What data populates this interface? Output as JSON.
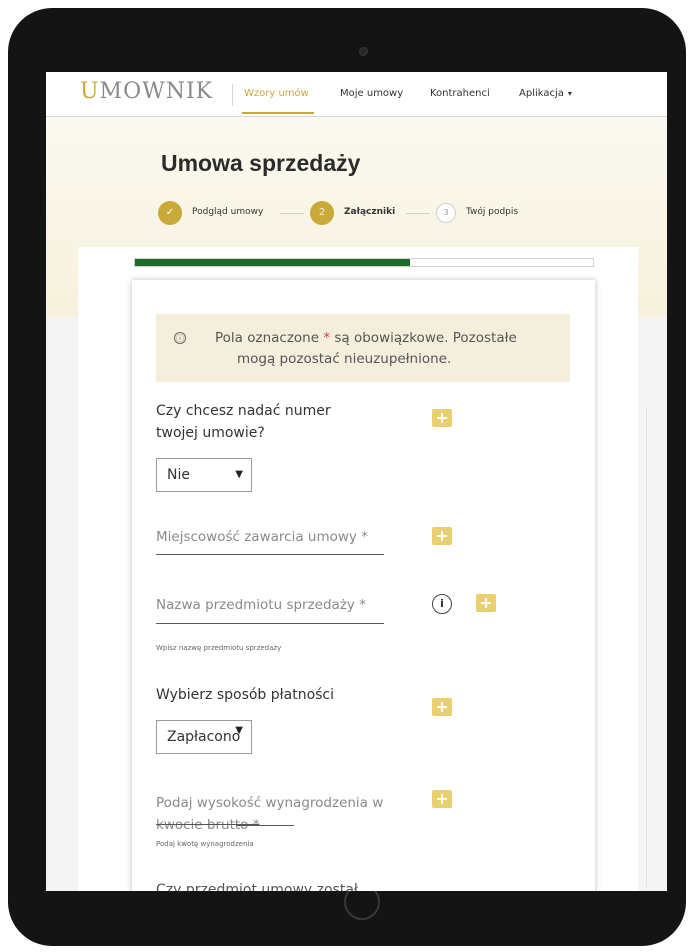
{
  "app": {
    "logo_u": "U",
    "logo_rest": "MOWNIK"
  },
  "nav": {
    "items": [
      {
        "label": "Wzory umów",
        "active": true
      },
      {
        "label": "Moje umowy"
      },
      {
        "label": "Kontrahenci"
      },
      {
        "label": "Aplikacja"
      }
    ],
    "dropdown_chevron": "▾"
  },
  "page": {
    "title": "Umowa sprzedaży"
  },
  "steps": [
    {
      "number": "✓",
      "label": "Podgląd umowy",
      "state": "done"
    },
    {
      "number": "2",
      "label": "Załączniki",
      "state": "current"
    },
    {
      "number": "3",
      "label": "Twój podpis",
      "state": "todo"
    }
  ],
  "progress": {
    "fraction": 0.6,
    "color": "#1e6b2b"
  },
  "notice": {
    "icon": "ⓘ",
    "text_before": "Pola oznaczone ",
    "star": "*",
    "text_after": " są obowiązkowe. Pozostałe",
    "line2": "mogą pozostać nieuzupełnione."
  },
  "form": {
    "contract_number": {
      "question_line1": "Czy chcesz nadać numer",
      "question_line2": "twojej umowie?",
      "value": "Nie",
      "arrow": "▼"
    },
    "place": {
      "label": "Miejscowość zawarcia umowy *"
    },
    "item_name": {
      "label": "Nazwa przedmiotu sprzedaży *",
      "info_icon": "i",
      "helper": "Wpisz nazwę przedmiotu sprzedaży"
    },
    "payment_method": {
      "question": "Wybierz sposób płatności",
      "value": "Zapłacono",
      "arrow": "▼"
    },
    "amount": {
      "label_line1": "Podaj wysokość wynagrodzenia w",
      "label_line2": "kwocie brutto *",
      "helper": "Podaj kwotę wynagrodzenia"
    },
    "cutoff_question": "Czy przedmiot umowy został"
  },
  "colors": {
    "accent_gold": "#c9a93a",
    "add_button": "#e9cf6e",
    "notice_bg": "#f4efdc",
    "required": "#e03a3a"
  },
  "icons": {
    "add": "plus-square-icon",
    "info": "info-circle-icon",
    "step_done": "check-icon"
  }
}
